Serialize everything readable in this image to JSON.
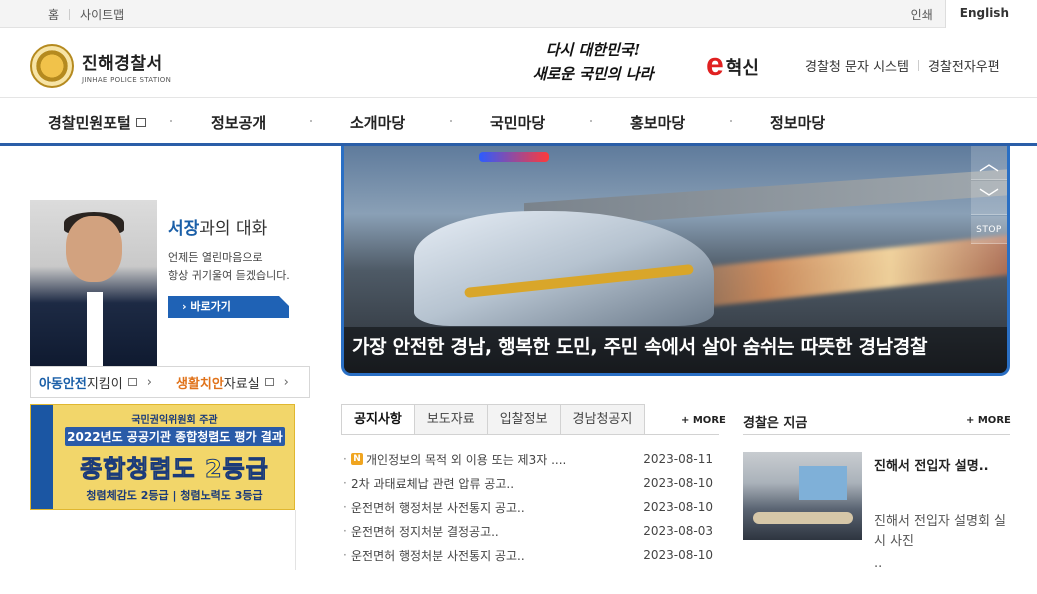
{
  "topbar": {
    "home": "홈",
    "sitemap": "사이트맵",
    "print": "인쇄",
    "english": "English"
  },
  "header": {
    "name": "진해경찰서",
    "name_en": "JINHAE POLICE STATION",
    "slogan_line1": "다시 대한민국!",
    "slogan_line2": "새로운 국민의 나라",
    "ehyeoksin_e": "e",
    "ehyeoksin_text": "혁신",
    "links": [
      "경찰청 문자 시스템",
      "경찰전자우편"
    ]
  },
  "gnb": {
    "items": [
      "경찰민원포털",
      "정보공개",
      "소개마당",
      "국민마당",
      "홍보마당",
      "정보마당"
    ]
  },
  "slider": {
    "caption": "가장 안전한 경남, 행복한 도민, 주민 속에서 살아 숨쉬는 따뜻한 경남경찰",
    "stop": "STOP"
  },
  "chief": {
    "title_bold": "서장",
    "title_rest": "과의 대화",
    "desc_line1": "언제든 열린마음으로",
    "desc_line2": "항상 귀기울여 듣겠습니다.",
    "button": "바로가기"
  },
  "quick": [
    {
      "bold": "아동안전",
      "rest": " 지킴이"
    },
    {
      "bold": "생활치안",
      "rest": " 자료실"
    }
  ],
  "banner": {
    "line1": "국민권익위원회 주관",
    "line2": "2022년도 공공기관 종합청렴도 평가 결과",
    "line3": "종합청렴도 2등급",
    "line4": "청렴체감도 2등급 | 청렴노력도 3등급"
  },
  "notice": {
    "tabs": [
      "공지사항",
      "보도자료",
      "입찰정보",
      "경남청공지"
    ],
    "more": "+ MORE",
    "new_badge": "N",
    "rows": [
      {
        "title": "개인정보의 목적 외 이용 또는 제3자 ....",
        "date": "2023-08-11"
      },
      {
        "title": "2차 과태료체납 관련 압류 공고..",
        "date": "2023-08-10"
      },
      {
        "title": "운전면허 행정처분 사전통지 공고..",
        "date": "2023-08-10"
      },
      {
        "title": "운전면허 정지처분 결정공고..",
        "date": "2023-08-03"
      },
      {
        "title": "운전면허 행정처분 사전통지 공고..",
        "date": "2023-08-10"
      }
    ]
  },
  "now": {
    "title": "경찰은 지금",
    "more": "+ MORE",
    "headline": "진해서 전입자 설명..",
    "desc": "진해서 전입자 설명회 실시 사진",
    "dots": ".."
  }
}
